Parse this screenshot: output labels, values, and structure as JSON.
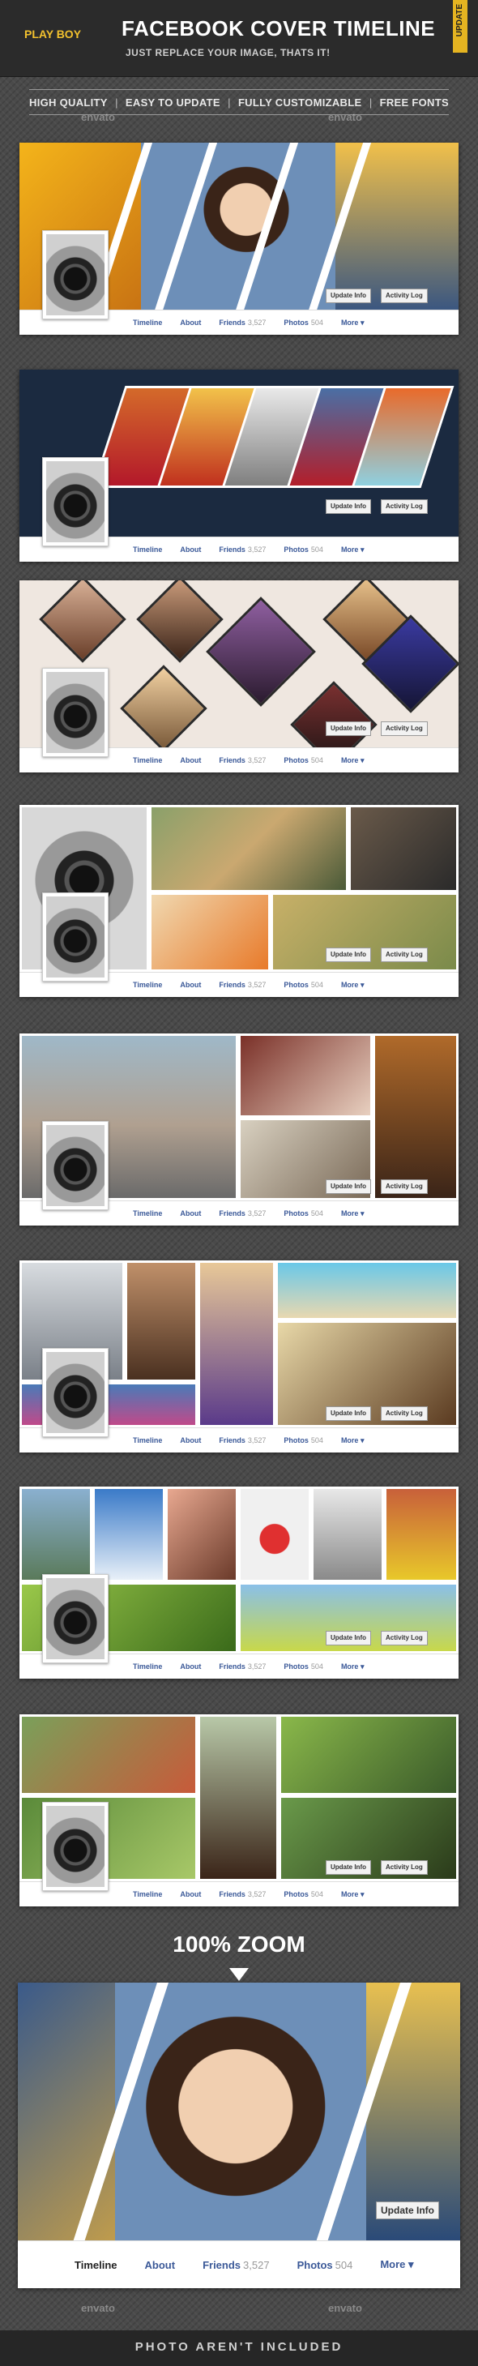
{
  "header": {
    "brand": "PLAY BOY",
    "title": "FACEBOOK COVER TIMELINE",
    "subtitle": "JUST REPLACE YOUR IMAGE, THATS IT!",
    "ribbon": "UPDATE"
  },
  "features": [
    "HIGH QUALITY",
    "EASY TO UPDATE",
    "FULLY CUSTOMIZABLE",
    "FREE FONTS"
  ],
  "watermark": "envato",
  "timeline": {
    "update_info": "Update Info",
    "activity_log": "Activity Log",
    "nav": {
      "timeline": "Timeline",
      "about": "About",
      "friends": "Friends",
      "friends_count": "3,527",
      "photos": "Photos",
      "photos_count": "504",
      "more": "More"
    }
  },
  "zoom_label": "100% ZOOM",
  "footer": "PHOTO AREN'T INCLUDED",
  "colors": {
    "header_bg": "#2b2b2b",
    "brand_yellow": "#f2c12e",
    "facebook_blue": "#3b5998",
    "cover_navy": "#27374f"
  }
}
